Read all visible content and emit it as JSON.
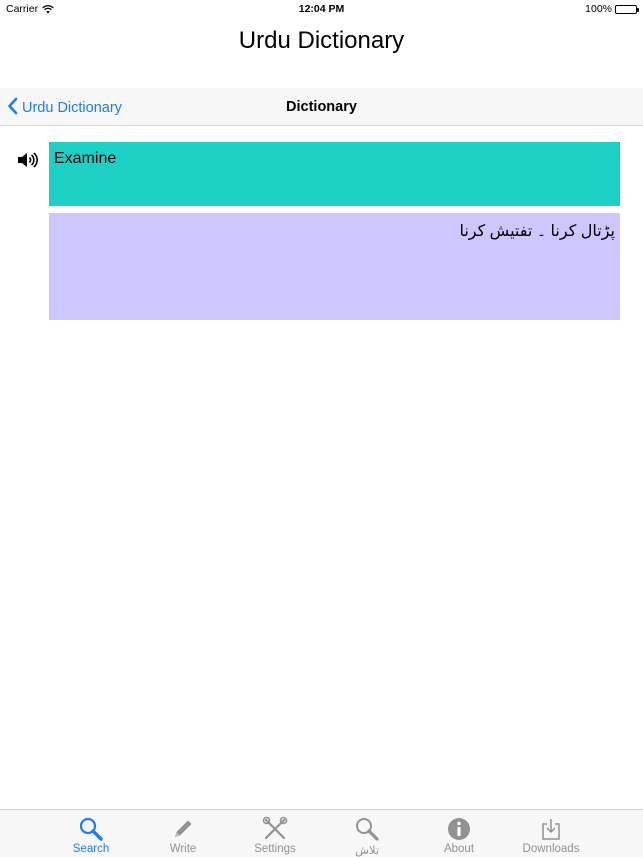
{
  "status_bar": {
    "carrier": "Carrier",
    "time": "12:04 PM",
    "battery": "100%"
  },
  "app_title": "Urdu Dictionary",
  "nav": {
    "back_label": "Urdu Dictionary",
    "title": "Dictionary"
  },
  "entry": {
    "word": "Examine",
    "meaning": "پڑتال کرنا ۔ تفتیش کرنا",
    "word_bg": "#1dd0c6",
    "meaning_bg": "#cec6fe"
  },
  "tabs": [
    {
      "label": "Search",
      "icon": "search-icon",
      "active": true
    },
    {
      "label": "Write",
      "icon": "pencil-icon",
      "active": false
    },
    {
      "label": "Settings",
      "icon": "tools-icon",
      "active": false
    },
    {
      "label": "تلاش",
      "icon": "search-icon",
      "active": false
    },
    {
      "label": "About",
      "icon": "info-icon",
      "active": false
    },
    {
      "label": "Downloads",
      "icon": "download-icon",
      "active": false
    }
  ],
  "colors": {
    "accent": "#1e7cf0",
    "inactive": "#929292"
  }
}
